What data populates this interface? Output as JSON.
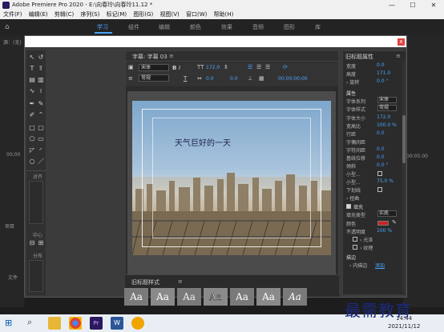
{
  "window": {
    "title": "Adobe Premiere Pro 2020 - E:\\向春玲\\向春玲11.12 *",
    "controls": [
      "—",
      "☐",
      "✕"
    ]
  },
  "menu": [
    "文件(F)",
    "编辑(E)",
    "剪辑(C)",
    "序列(S)",
    "标记(M)",
    "图形(G)",
    "视图(V)",
    "窗口(W)",
    "帮助(H)"
  ],
  "workspaces": [
    "学习",
    "组件",
    "编辑",
    "颜色",
    "效果",
    "音频",
    "图形",
    "库"
  ],
  "background": {
    "left_label": "源：(无)",
    "left_time": "00;00",
    "right_time": "00:05:00",
    "bottom_left_1": "项目",
    "bottom_left_2": "文件"
  },
  "dialog": {
    "close": "x",
    "tools": {
      "align_label": "对齐",
      "center_label": "中心",
      "distribute_label": "分布"
    },
    "main": {
      "tab": "字幕: 字幕 03",
      "menu_icon": "≡",
      "font": "宋体",
      "style": "常规",
      "size_label": "TT",
      "size": "172.0",
      "kerning": "0.0",
      "leading": "0.0",
      "timecode": "00:00:00:00",
      "subtitle_text": "天气巨好的一天"
    },
    "props": {
      "title": "旧标题属性",
      "rows": [
        {
          "label": "宽度",
          "value": "0.0"
        },
        {
          "label": "高度",
          "value": "171.0"
        },
        {
          "label": "› 旋转",
          "value": "0.0 °"
        }
      ],
      "section_attr": "属性",
      "attr_rows": [
        {
          "label": "字体系列",
          "dd": "宋体"
        },
        {
          "label": "字体样式",
          "dd": "常规"
        },
        {
          "label": "字体大小",
          "value": "172.0"
        },
        {
          "label": "宽高比",
          "value": "100.0 %"
        },
        {
          "label": "行距",
          "value": "0.0"
        },
        {
          "label": "字偶间距",
          "value": ""
        },
        {
          "label": "字符间距",
          "value": "0.0"
        },
        {
          "label": "基线位移",
          "value": "0.0"
        },
        {
          "label": "倾斜",
          "value": "0.0 °"
        },
        {
          "label": "小型...",
          "value": ""
        },
        {
          "label": "小型...",
          "value": "75.0 %"
        },
        {
          "label": "下划线",
          "value": ""
        },
        {
          "label": "› 扭曲",
          "value": ""
        }
      ],
      "section_fill": "填充",
      "fill_rows": [
        {
          "label": "填充类型",
          "dd": "实底"
        },
        {
          "label": "颜色",
          "value": ""
        },
        {
          "label": "不透明度",
          "value": "100 %"
        },
        {
          "label": "› 光泽",
          "value": ""
        },
        {
          "label": "› 纹理",
          "value": ""
        }
      ],
      "section_stroke": "描边",
      "stroke_row": {
        "label": "› 内描边",
        "link": "添加"
      },
      "fill_color": "#cc2222"
    },
    "styles": {
      "title": "旧标题样式",
      "items": [
        "Aa",
        "Aa",
        "Aa",
        "Aa",
        "Aa",
        "Aa",
        "Aa"
      ]
    }
  },
  "taskbar": {
    "time": "14:44",
    "date": "2021/11/12"
  },
  "watermark": "最需教育"
}
